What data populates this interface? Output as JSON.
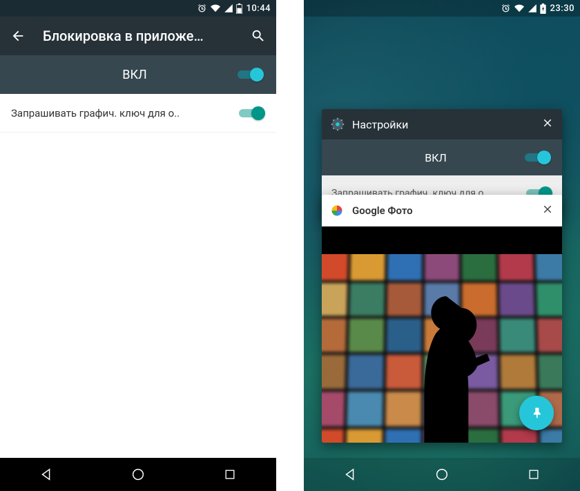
{
  "left": {
    "status": {
      "time": "10:44"
    },
    "appbar": {
      "title": "Блокировка в приложе…"
    },
    "master": {
      "label": "ВКЛ"
    },
    "setting1": {
      "label": "Запрашивать графич. ключ для о.."
    }
  },
  "right": {
    "status": {
      "time": "23:30"
    },
    "cards": {
      "settings": {
        "title": "Настройки",
        "master_label": "ВКЛ",
        "setting_label": "Запрашивать графич. ключ для о.."
      },
      "photos": {
        "title": "Google Фото"
      }
    }
  },
  "tile_colors": [
    "#d24a2a",
    "#d99a33",
    "#2f6fb3",
    "#8c4a7a",
    "#2a6d3f",
    "#b23a4a",
    "#3b7ba6",
    "#caa35a",
    "#3a7d63",
    "#a65a3a",
    "#5a7aa8",
    "#c96c2d",
    "#6a4a8a",
    "#2f8f6a",
    "#b56a3a",
    "#5a8a4a",
    "#2a5f8a",
    "#c97a3a",
    "#7a3a5a",
    "#3a8a7a",
    "#a84a4a",
    "#9a6a3a",
    "#3a6a9a",
    "#c95a3a",
    "#5a9a6a",
    "#7a5aa0",
    "#b07a3a",
    "#3a7a5a",
    "#a64a6a",
    "#4a8ab0",
    "#c98a4a",
    "#5a6a9a",
    "#8a4a6a",
    "#3a9a7a",
    "#b06a4a"
  ]
}
